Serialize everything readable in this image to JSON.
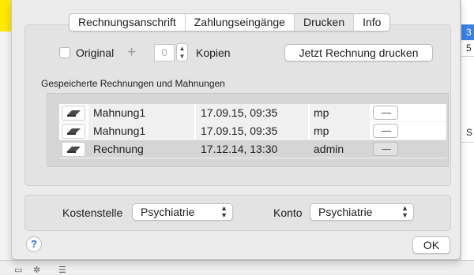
{
  "background": {
    "right_rows": [
      "3",
      "5",
      "S"
    ]
  },
  "tabs": [
    {
      "label": "Rechnungsanschrift",
      "active": false
    },
    {
      "label": "Zahlungseingänge",
      "active": false
    },
    {
      "label": "Drucken",
      "active": true
    },
    {
      "label": "Info",
      "active": false
    }
  ],
  "print": {
    "original_label": "Original",
    "plus_symbol": "+",
    "copies_value": "0",
    "copies_label": "Kopien",
    "print_button_label": "Jetzt Rechnung drucken"
  },
  "saved": {
    "section_title": "Gespeicherte Rechnungen und Mahnungen",
    "rows": [
      {
        "name": "Mahnung1",
        "date": "17.09.15, 09:35",
        "user": "mp",
        "selected": false
      },
      {
        "name": "Mahnung1",
        "date": "17.09.15, 09:35",
        "user": "mp",
        "selected": false
      },
      {
        "name": "Rechnung",
        "date": "17.12.14, 13:30",
        "user": "admin",
        "selected": true
      }
    ]
  },
  "footer": {
    "kostenstelle_label": "Kostenstelle",
    "kostenstelle_value": "Psychiatrie",
    "konto_label": "Konto",
    "konto_value": "Psychiatrie",
    "help_symbol": "?",
    "ok_label": "OK"
  },
  "colors": {
    "accent": "#3b82e0",
    "highlight_yellow": "#ffe900"
  }
}
